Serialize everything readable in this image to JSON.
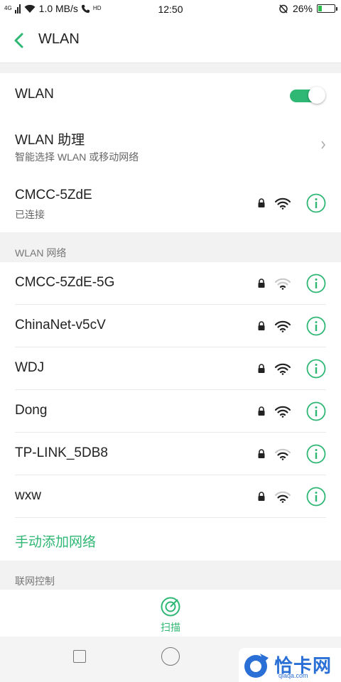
{
  "status_bar": {
    "network_type": "4G",
    "speed": "1.0 MB/s",
    "hd_badge": "HD",
    "time": "12:50",
    "battery": "26%",
    "battery_level": 0.26
  },
  "header": {
    "title": "WLAN"
  },
  "wlan_toggle": {
    "label": "WLAN",
    "on": true
  },
  "assistant": {
    "title": "WLAN 助理",
    "subtitle": "智能选择 WLAN 或移动网络"
  },
  "connected": {
    "ssid": "CMCC-5ZdE",
    "status": "已连接"
  },
  "networks_section": {
    "label": "WLAN 网络"
  },
  "networks": [
    {
      "ssid": "CMCC-5ZdE-5G",
      "signal": "weak"
    },
    {
      "ssid": "ChinaNet-v5cV",
      "signal": "strong"
    },
    {
      "ssid": "WDJ",
      "signal": "strong"
    },
    {
      "ssid": "Dong",
      "signal": "strong"
    },
    {
      "ssid": "TP-LINK_5DB8",
      "signal": "medium"
    },
    {
      "ssid": "wxw",
      "signal": "medium"
    }
  ],
  "add_network": {
    "label": "手动添加网络"
  },
  "control_section": {
    "label": "联网控制"
  },
  "scan": {
    "label": "扫描"
  },
  "watermark": {
    "text": "恰卡网",
    "url": "qiaqa.com"
  },
  "colors": {
    "accent": "#2fb774",
    "section_bg": "#f2f2f2",
    "watermark_blue": "#2a6fd6"
  }
}
